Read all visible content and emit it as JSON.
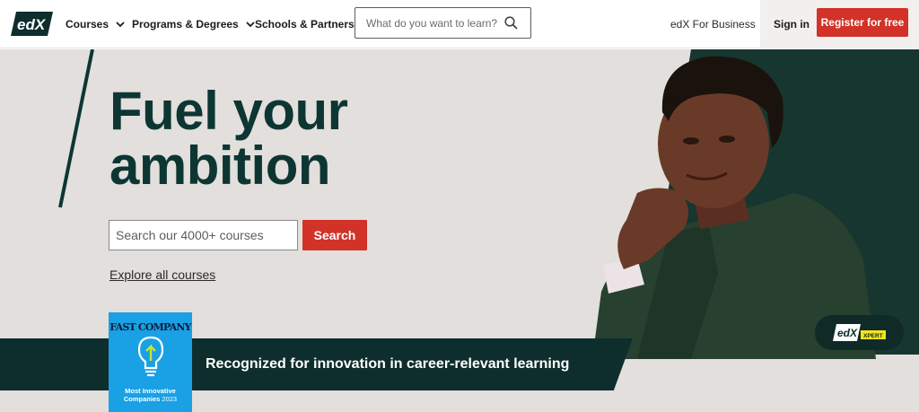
{
  "nav": {
    "logo_text": "edX",
    "items": [
      {
        "label": "Courses"
      },
      {
        "label": "Programs & Degrees"
      },
      {
        "label": "Schools & Partners"
      }
    ],
    "search_placeholder": "What do you want to learn?",
    "business_label": "edX For Business",
    "signin_label": "Sign in",
    "register_label": "Register for free"
  },
  "hero": {
    "headline_line1": "Fuel your",
    "headline_line2": "ambition",
    "search_placeholder": "Search our 4000+ courses",
    "search_button": "Search",
    "explore_link": "Explore all courses"
  },
  "recognition": {
    "text": "Recognized for innovation in career-relevant learning",
    "badge_title": "FAST COMPANY",
    "badge_line1": "Most Innovative",
    "badge_line2": "Companies",
    "badge_year": "2023"
  },
  "xpert": {
    "logo_text": "edX",
    "tag": "XPERT"
  },
  "colors": {
    "brand_red": "#d23228",
    "dark_teal": "#0d3633",
    "band": "#0e2e2d",
    "hero_bg": "#e2dfdc",
    "badge_blue": "#1aa0e4"
  }
}
